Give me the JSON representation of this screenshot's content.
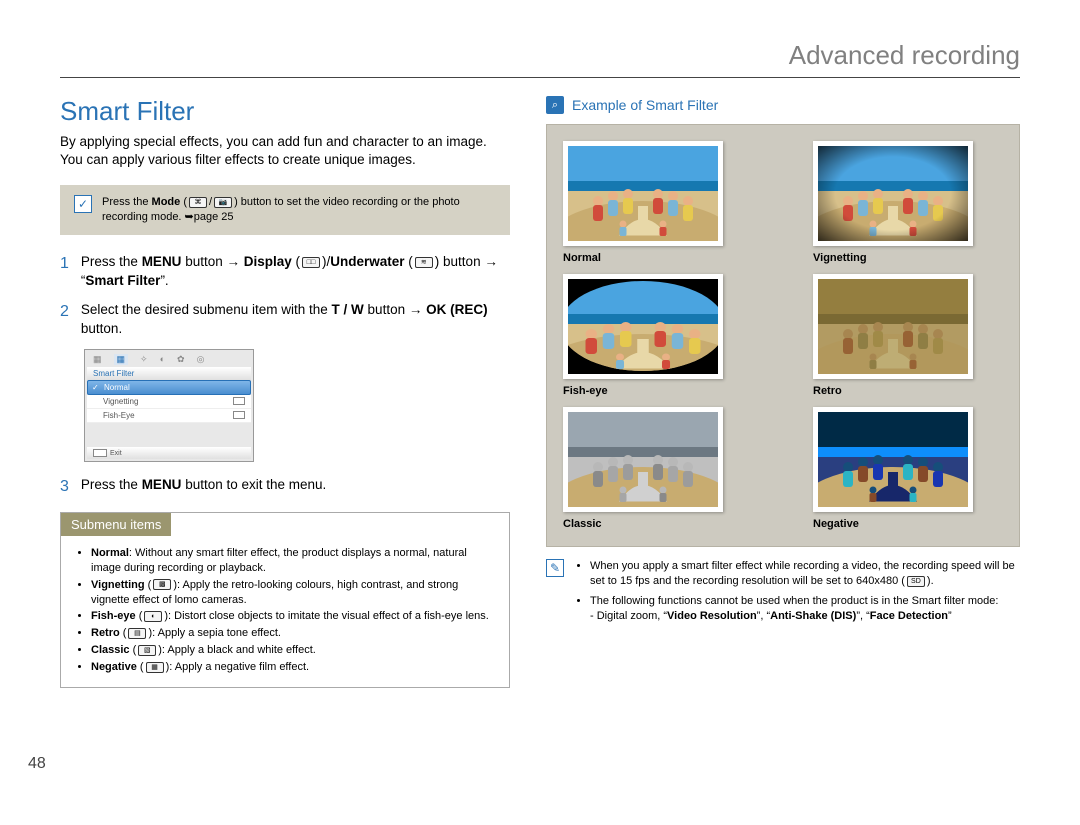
{
  "header": {
    "title": "Advanced recording"
  },
  "page_number": "48",
  "section": {
    "title": "Smart Filter",
    "intro": "By applying special effects, you can add fun and character to an image. You can apply various filter effects to create unique images."
  },
  "prenote": {
    "text_before": "Press the ",
    "mode_word": "Mode",
    "icon_a": "⌘",
    "icon_b": "📷",
    "text_after": " button to set the video recording or the photo recording mode. ",
    "pageref": "➥page 25"
  },
  "steps": [
    {
      "num": "1",
      "parts": {
        "a": "Press the ",
        "menu": "MENU",
        "b": " button → ",
        "display": "Display",
        "c": " (",
        "icon1": "□□",
        "d": ")/",
        "underwater": "Underwater",
        "e": " (",
        "icon2": "≋",
        "f": ") button → “",
        "sf": "Smart Filter",
        "g": "”."
      }
    },
    {
      "num": "2",
      "parts": {
        "a": "Select the desired submenu item with the ",
        "tw": "T / W",
        "b": " button → ",
        "ok": "OK (REC)",
        "c": " button."
      }
    },
    {
      "num": "3",
      "parts": {
        "a": "Press the ",
        "menu": "MENU",
        "b": " button to exit the menu."
      }
    }
  ],
  "osd": {
    "label": "Smart Filter",
    "items": [
      "Normal",
      "Vignetting",
      "Fish-Eye"
    ],
    "selected_index": 0,
    "exit": "Exit"
  },
  "submenu": {
    "header": "Submenu items",
    "items": [
      {
        "name": "Normal",
        "desc": ": Without any smart filter effect, the product displays a normal, natural image during recording or playback.",
        "icon": null
      },
      {
        "name": "Vignetting",
        "desc": "): Apply the retro-looking colours, high contrast, and strong vignette effect of lomo cameras.",
        "icon": "▩"
      },
      {
        "name": "Fish-eye",
        "desc": "): Distort close objects to imitate the visual effect of a fish-eye lens.",
        "icon": "◐"
      },
      {
        "name": "Retro",
        "desc": "): Apply a sepia tone effect.",
        "icon": "▤"
      },
      {
        "name": "Classic",
        "desc": "): Apply a black and white effect.",
        "icon": "▧"
      },
      {
        "name": "Negative",
        "desc": "): Apply a negative film effect.",
        "icon": "▦"
      }
    ]
  },
  "example": {
    "title": "Example of Smart Filter",
    "thumbs": [
      {
        "label": "Normal",
        "filter": "none"
      },
      {
        "label": "Vignetting",
        "filter": "vignette"
      },
      {
        "label": "Fish-eye",
        "filter": "fisheye"
      },
      {
        "label": "Retro",
        "filter": "retro"
      },
      {
        "label": "Classic",
        "filter": "classic"
      },
      {
        "label": "Negative",
        "filter": "negative"
      }
    ]
  },
  "notes": {
    "items": [
      {
        "a": "When you apply a smart filter effect while recording a video, the recording speed will be set to 15 fps and the recording resolution will be set to 640x480 (",
        "icon": "SD",
        "b": ")."
      },
      {
        "a": "The following functions cannot be used when the product is in the Smart filter mode:",
        "b": "",
        "icon": null,
        "sub": "- Digital zoom, “",
        "bold1": "Video Resolution",
        "mid1": "”, “",
        "bold2": "Anti-Shake (DIS)",
        "mid2": "”, “",
        "bold3": "Face Detection",
        "end": "”"
      }
    ]
  }
}
